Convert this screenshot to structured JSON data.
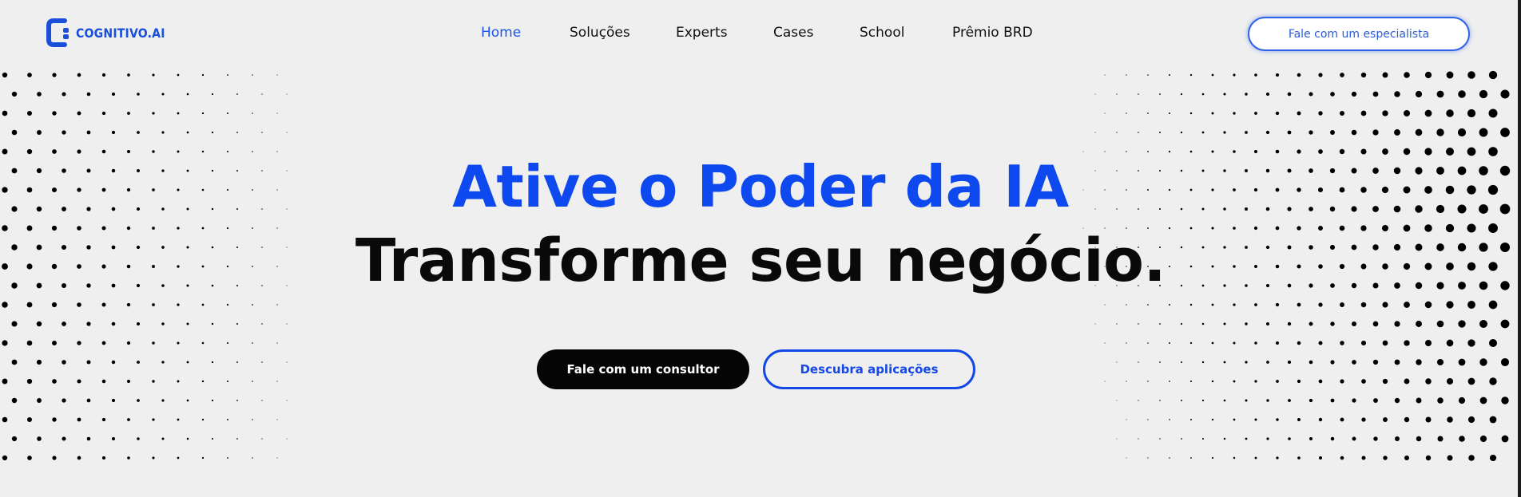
{
  "brand": {
    "name": "COGNITIVO.AI",
    "color": "#1a4fd9"
  },
  "nav": {
    "items": [
      {
        "label": "Home",
        "active": true
      },
      {
        "label": "Soluções",
        "active": false
      },
      {
        "label": "Experts",
        "active": false
      },
      {
        "label": "Cases",
        "active": false
      },
      {
        "label": "School",
        "active": false
      },
      {
        "label": "Prêmio BRD",
        "active": false
      }
    ],
    "active_color": "#1a56e8"
  },
  "header_cta": {
    "label": "Fale com um especialista"
  },
  "hero": {
    "title": "Ative o Poder da IA",
    "subtitle": "Transforme seu negócio.",
    "title_color": "#0e49f0",
    "primary_button": "Fale com um consultor",
    "secondary_button": "Descubra aplicações"
  },
  "decoration": {
    "pattern": "halftone-dots",
    "dot_color": "#000000"
  }
}
